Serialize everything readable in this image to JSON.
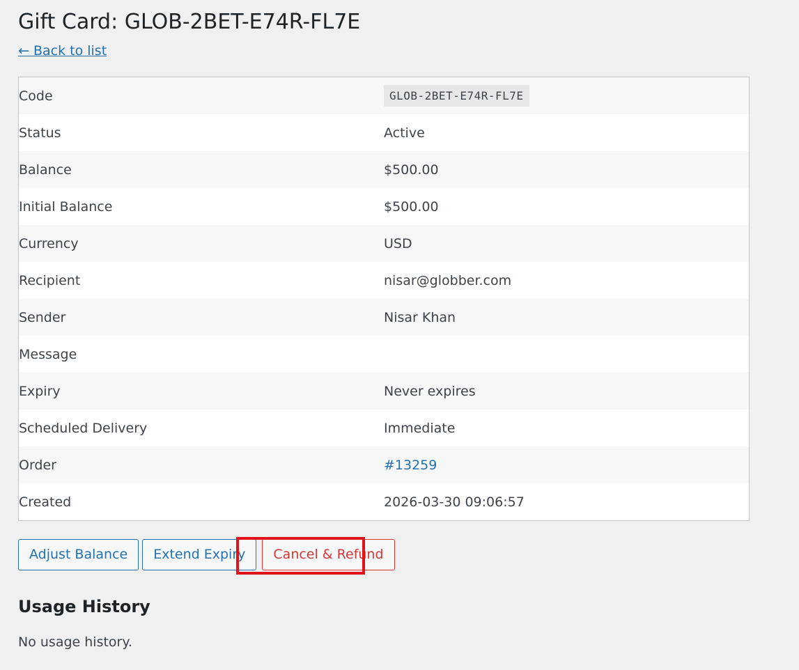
{
  "page": {
    "title": "Gift Card: GLOB-2BET-E74R-FL7E",
    "back_link": "← Back to list"
  },
  "details": {
    "code": {
      "label": "Code",
      "value": "GLOB-2BET-E74R-FL7E"
    },
    "status": {
      "label": "Status",
      "value": "Active"
    },
    "balance": {
      "label": "Balance",
      "value": "$500.00"
    },
    "initial_balance": {
      "label": "Initial Balance",
      "value": "$500.00"
    },
    "currency": {
      "label": "Currency",
      "value": "USD"
    },
    "recipient": {
      "label": "Recipient",
      "value": "nisar@globber.com"
    },
    "sender": {
      "label": "Sender",
      "value": "Nisar Khan"
    },
    "message": {
      "label": "Message",
      "value": ""
    },
    "expiry": {
      "label": "Expiry",
      "value": "Never expires"
    },
    "scheduled_delivery": {
      "label": "Scheduled Delivery",
      "value": "Immediate"
    },
    "order": {
      "label": "Order",
      "value": "#13259"
    },
    "created": {
      "label": "Created",
      "value": "2026-03-30 09:06:57"
    }
  },
  "actions": {
    "adjust_balance": "Adjust Balance",
    "extend_expiry": "Extend Expiry",
    "cancel_refund": "Cancel & Refund"
  },
  "usage_history": {
    "title": "Usage History",
    "empty_text": "No usage history."
  },
  "colors": {
    "link": "#2271b1",
    "danger": "#d63638",
    "highlight": "#e0121b",
    "background": "#f0f0f1"
  }
}
